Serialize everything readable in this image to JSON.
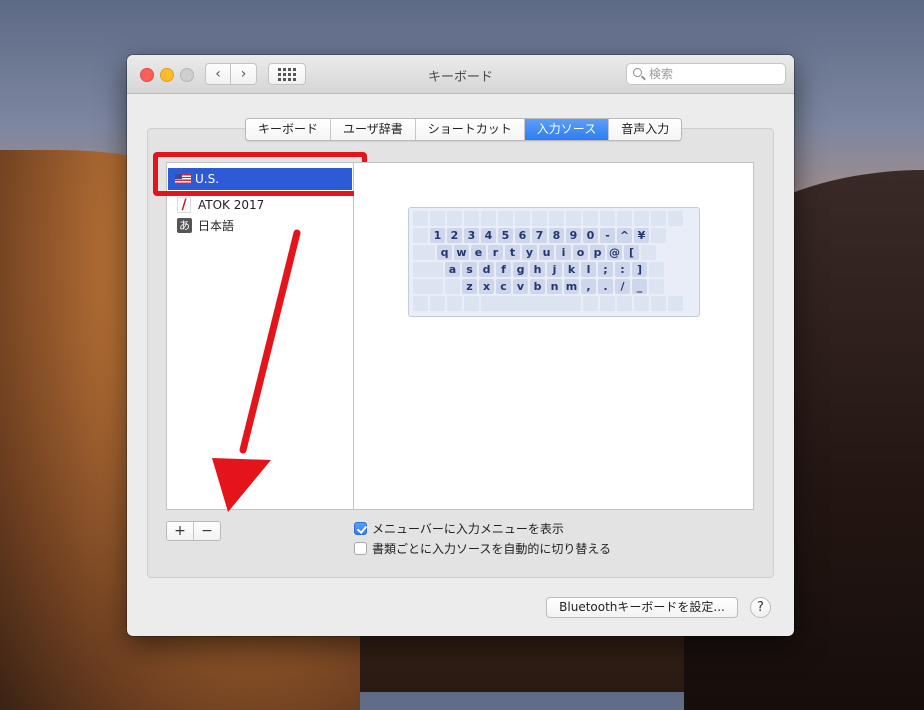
{
  "window": {
    "title": "キーボード",
    "search_placeholder": "検索"
  },
  "tabs": [
    {
      "label": "キーボード",
      "active": false
    },
    {
      "label": "ユーザ辞書",
      "active": false
    },
    {
      "label": "ショートカット",
      "active": false
    },
    {
      "label": "入力ソース",
      "active": true
    },
    {
      "label": "音声入力",
      "active": false
    }
  ],
  "input_sources": [
    {
      "label": "U.S.",
      "icon": "us-flag-icon",
      "selected": true
    },
    {
      "label": "ATOK 2017",
      "icon": "atok-icon",
      "selected": false
    },
    {
      "label": "日本語",
      "icon": "japanese-a-icon",
      "glyph": "あ",
      "selected": false
    }
  ],
  "keyboard_layout": {
    "rows": [
      [
        "1",
        "2",
        "3",
        "4",
        "5",
        "6",
        "7",
        "8",
        "9",
        "0",
        "-",
        "^",
        "¥"
      ],
      [
        "q",
        "w",
        "e",
        "r",
        "t",
        "y",
        "u",
        "i",
        "o",
        "p",
        "@",
        "["
      ],
      [
        "a",
        "s",
        "d",
        "f",
        "g",
        "h",
        "j",
        "k",
        "l",
        ";",
        ":",
        "]"
      ],
      [
        "z",
        "x",
        "c",
        "v",
        "b",
        "n",
        "m",
        ",",
        ".",
        "/",
        "_"
      ]
    ]
  },
  "list_controls": {
    "add_label": "+",
    "remove_label": "−"
  },
  "options": {
    "show_input_menu": {
      "label": "メニューバーに入力メニューを表示",
      "checked": true
    },
    "auto_switch": {
      "label": "書類ごとに入力ソースを自動的に切り替える",
      "checked": false
    }
  },
  "bluetooth_button": "Bluetoothキーボードを設定...",
  "help_label": "?",
  "colors": {
    "accent": "#2f7bf3",
    "annotation_red": "#e3151a",
    "selection": "#2d5bd8"
  }
}
